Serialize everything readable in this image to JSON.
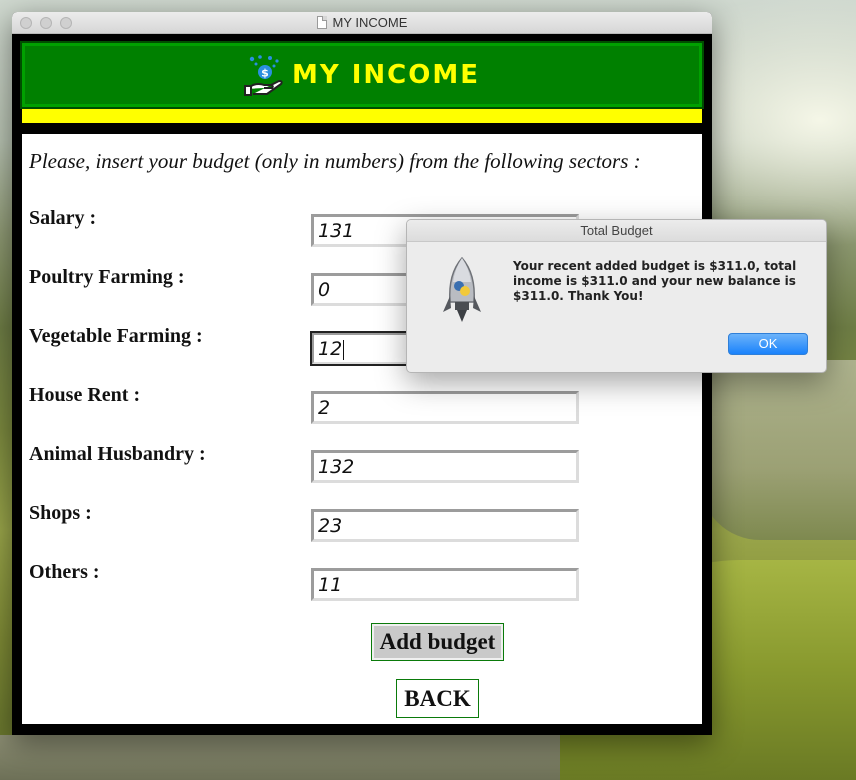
{
  "window": {
    "title": "MY INCOME"
  },
  "banner": {
    "title": "MY INCOME",
    "icon": "money-hand-icon"
  },
  "form": {
    "intro": "Please, insert your budget (only in numbers) from the following sectors :",
    "rows": [
      {
        "label": "Salary :",
        "value": "131"
      },
      {
        "label": "Poultry Farming :",
        "value": "0"
      },
      {
        "label": "Vegetable Farming :",
        "value": "12",
        "focused": true
      },
      {
        "label": "House Rent :",
        "value": "2"
      },
      {
        "label": "Animal Husbandry :",
        "value": "132"
      },
      {
        "label": "Shops :",
        "value": "23"
      },
      {
        "label": "Others :",
        "value": "11"
      }
    ],
    "add_budget_label": "Add budget",
    "back_label": "BACK"
  },
  "dialog": {
    "title": "Total Budget",
    "message": "Your recent added budget is $311.0, total income is $311.0 and your new balance is $311.0. Thank You!",
    "ok_label": "OK",
    "icon": "python-rocket-icon"
  },
  "colors": {
    "banner_green": "#008000",
    "banner_text": "#ffff00",
    "yellow_bar": "#ffff00",
    "ok_blue": "#1a82fb"
  }
}
